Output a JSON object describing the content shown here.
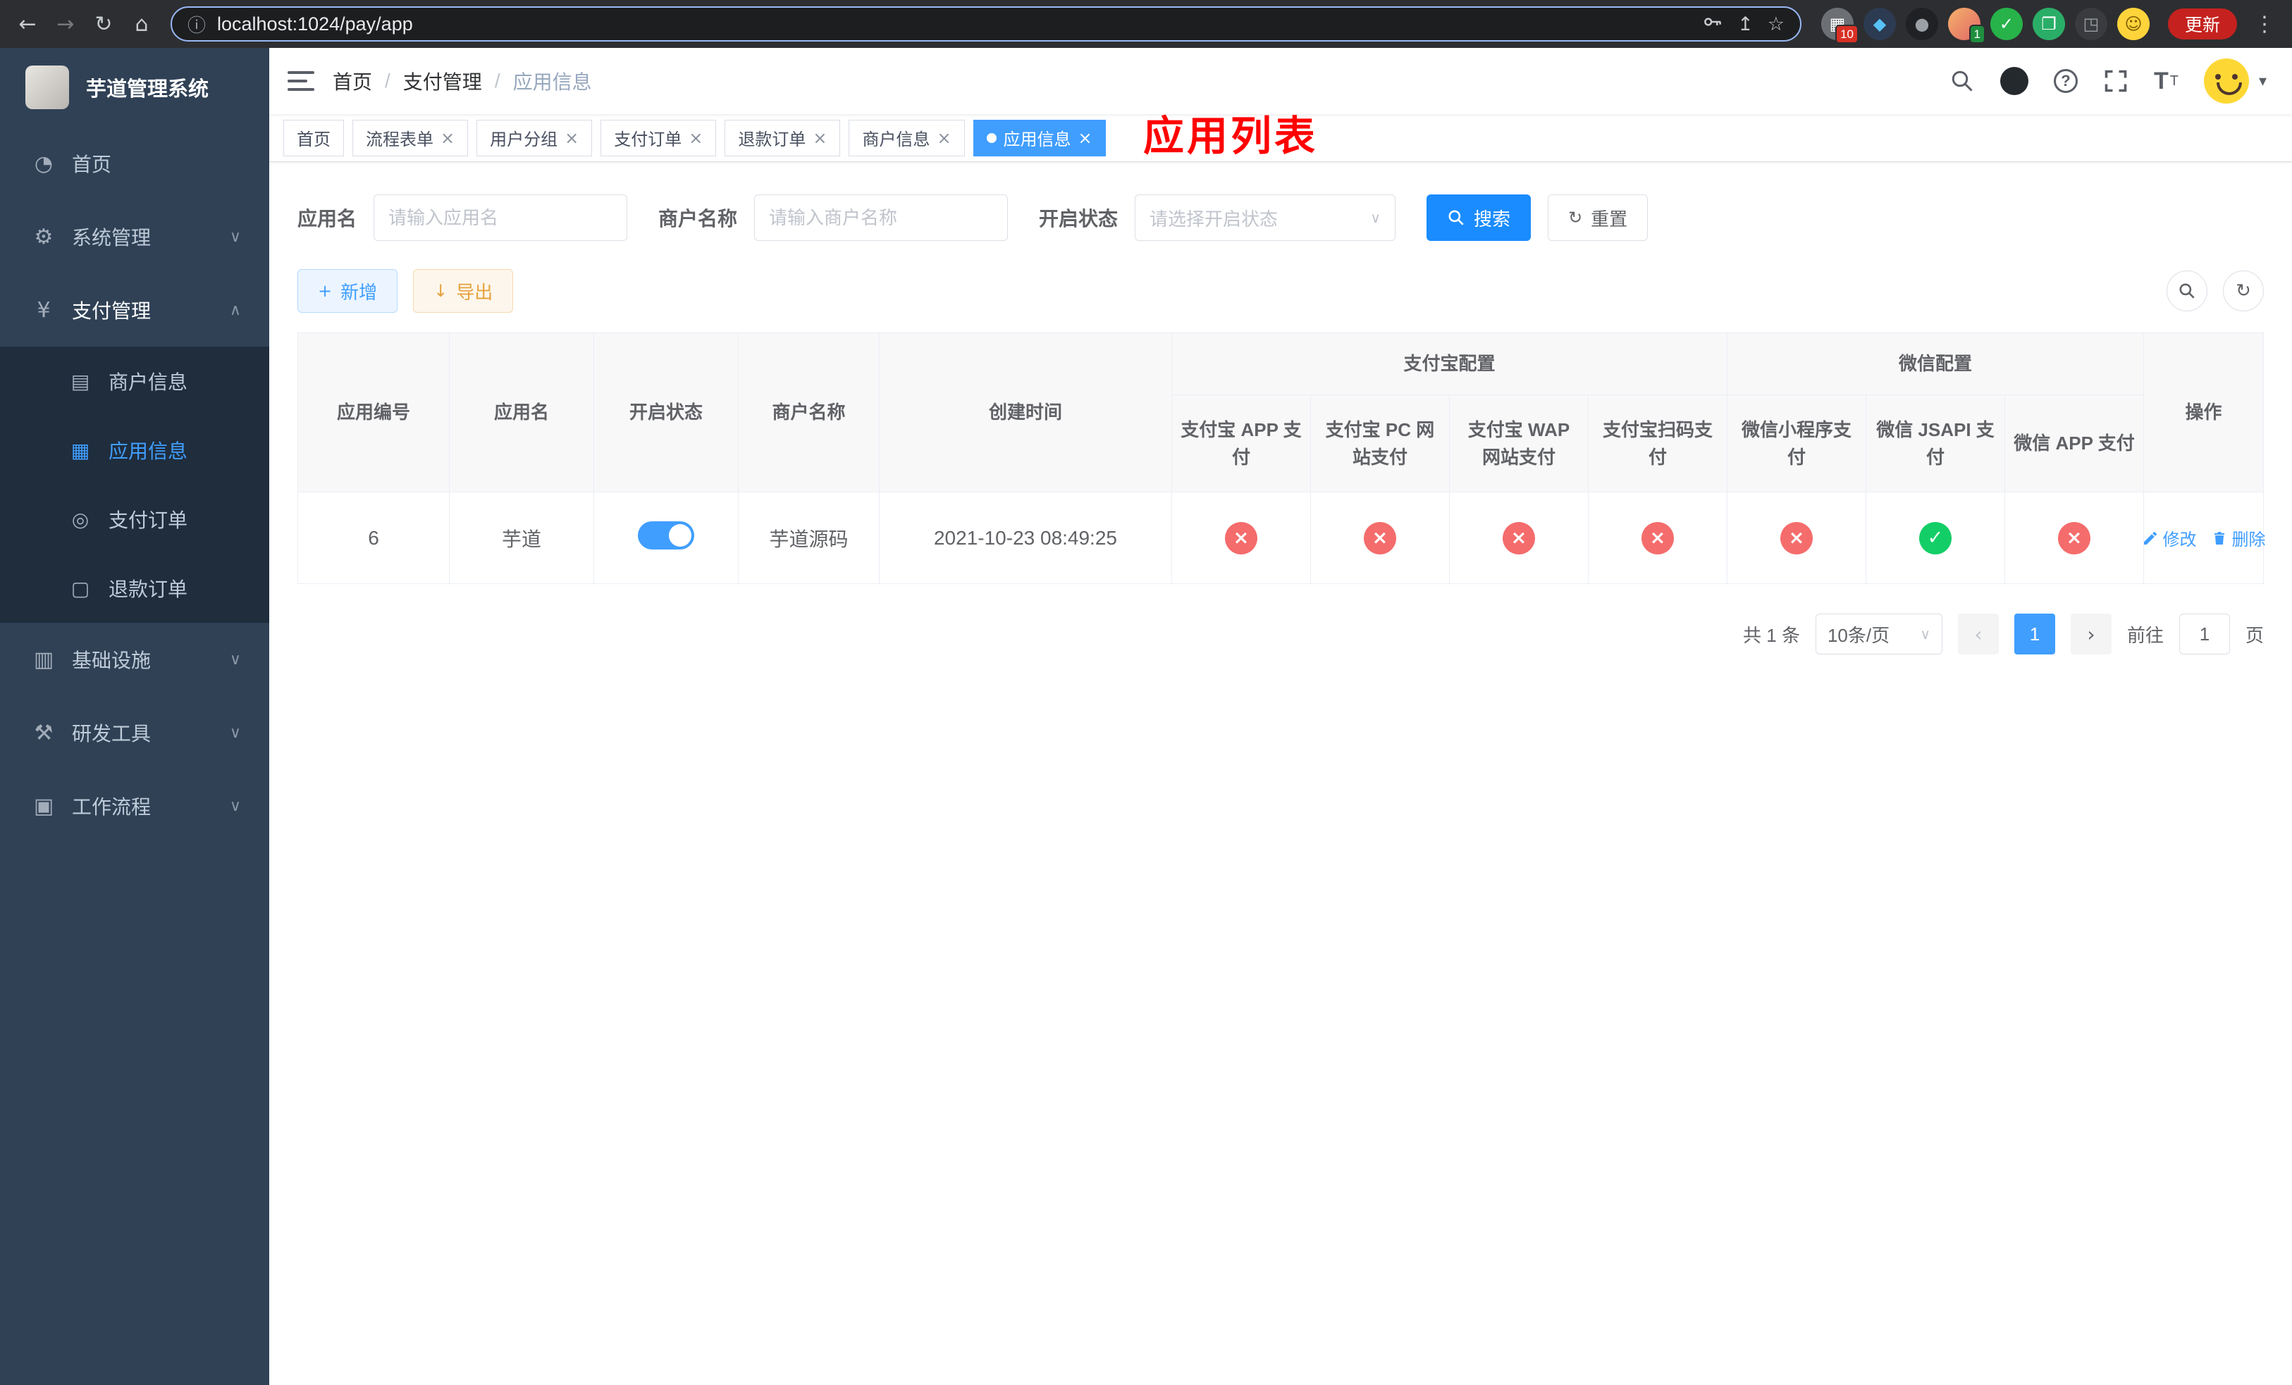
{
  "colors": {
    "primary": "#409eff",
    "success": "#13ce66",
    "danger": "#f56c6c",
    "warning": "#e6a23c",
    "annotation_red": "#ff0000",
    "sidebar_bg": "#304156",
    "submenu_bg": "#1f2d3d"
  },
  "icons": {
    "back": "←",
    "forward": "→",
    "reload": "↻",
    "home": "⌂",
    "info": "ⓘ",
    "share": "↥",
    "star": "☆",
    "kebab": "⋮",
    "chevron_down": "∨",
    "chevron_up": "∧",
    "caret_down": "▾",
    "plus": "+",
    "download": "↓",
    "refresh": "↻",
    "check": "✓",
    "cross": "×",
    "close": "×",
    "question": "?",
    "font_size": "T",
    "prev": "‹",
    "next": "›"
  },
  "browser": {
    "url": "localhost:1024/pay/app",
    "update_label": "更新",
    "extensions": [
      {
        "glyph": "▦",
        "badge": "10"
      },
      {
        "glyph": "◆",
        "badge": ""
      },
      {
        "glyph": "●",
        "badge": ""
      },
      {
        "glyph": "",
        "badge": "1"
      },
      {
        "glyph": "✓",
        "badge": ""
      },
      {
        "glyph": "❐",
        "badge": ""
      },
      {
        "glyph": "◳",
        "badge": ""
      },
      {
        "glyph": "☺",
        "badge": ""
      }
    ]
  },
  "sidebar": {
    "title": "芋道管理系统",
    "items": [
      {
        "label": "首页",
        "glyph": "◔"
      },
      {
        "label": "系统管理",
        "glyph": "⚙"
      },
      {
        "label": "支付管理",
        "glyph": "¥"
      },
      {
        "label": "基础设施",
        "glyph": "▥"
      },
      {
        "label": "研发工具",
        "glyph": "⚒"
      },
      {
        "label": "工作流程",
        "glyph": "▣"
      }
    ],
    "payment_children": [
      {
        "label": "商户信息",
        "glyph": "▤"
      },
      {
        "label": "应用信息",
        "glyph": "▦"
      },
      {
        "label": "支付订单",
        "glyph": "◎"
      },
      {
        "label": "退款订单",
        "glyph": "▢"
      }
    ]
  },
  "header": {
    "breadcrumb": [
      "首页",
      "支付管理",
      "应用信息"
    ],
    "breadcrumb_separator": "/",
    "annotation": "应用列表"
  },
  "tabs": [
    {
      "label": "首页"
    },
    {
      "label": "流程表单"
    },
    {
      "label": "用户分组"
    },
    {
      "label": "支付订单"
    },
    {
      "label": "退款订单"
    },
    {
      "label": "商户信息"
    },
    {
      "label": "应用信息"
    }
  ],
  "filters": {
    "app_name_label": "应用名",
    "app_name_placeholder": "请输入应用名",
    "merchant_label": "商户名称",
    "merchant_placeholder": "请输入商户名称",
    "status_label": "开启状态",
    "status_placeholder": "请选择开启状态",
    "search_button": "搜索",
    "reset_button": "重置"
  },
  "toolbar": {
    "add_button": "新增",
    "export_button": "导出"
  },
  "table": {
    "groups": {
      "alipay": "支付宝配置",
      "wechat": "微信配置"
    },
    "columns": [
      "应用编号",
      "应用名",
      "开启状态",
      "商户名称",
      "创建时间",
      "支付宝 APP 支付",
      "支付宝 PC 网站支付",
      "支付宝 WAP 网站支付",
      "支付宝扫码支付",
      "微信小程序支付",
      "微信 JSAPI 支付",
      "微信 APP 支付",
      "操作"
    ],
    "rows": [
      {
        "id": "6",
        "name": "芋道",
        "enabled": true,
        "merchant": "芋道源码",
        "created": "2021-10-23 08:49:25",
        "channels": {
          "alipay_app": false,
          "alipay_pc": false,
          "alipay_wap": false,
          "alipay_qr": false,
          "wechat_lite": false,
          "wechat_jsapi": true,
          "wechat_app": false
        },
        "actions": {
          "edit": "修改",
          "delete": "删除"
        }
      }
    ]
  },
  "pagination": {
    "total": "共 1 条",
    "page_size": "10条/页",
    "current_page": "1",
    "goto_label": "前往",
    "goto_value": "1",
    "page_unit": "页"
  }
}
